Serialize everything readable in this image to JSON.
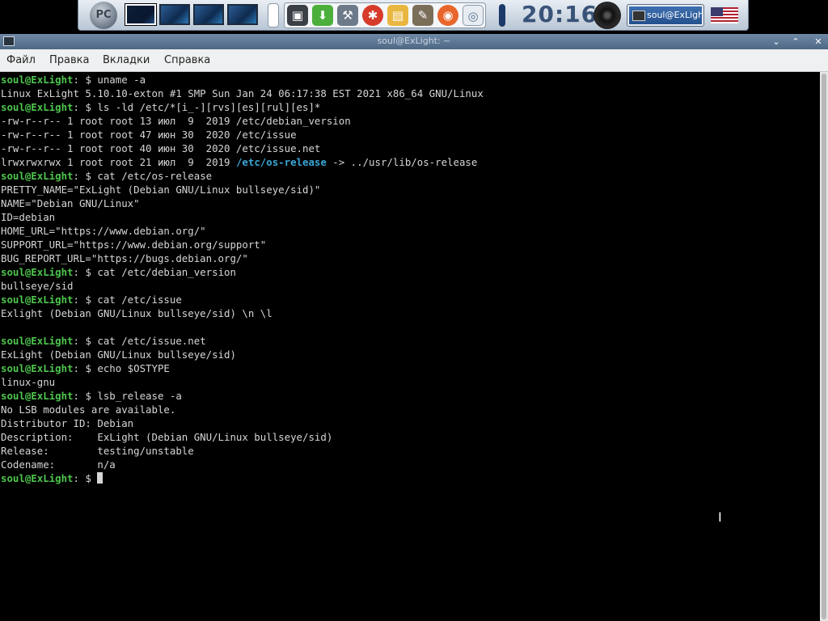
{
  "panel": {
    "logo_text": "PC",
    "clock": "20:16",
    "task_button_label": "soul@ExLight...",
    "icons": [
      "monitor-icon",
      "download-icon",
      "settings-tools-icon",
      "software-icon",
      "folder-icon",
      "gimp-icon",
      "firefox-icon",
      "network-icon"
    ]
  },
  "window": {
    "title": "soul@ExLight: ~"
  },
  "menu": {
    "file": "Файл",
    "edit": "Правка",
    "tabs": "Вкладки",
    "help": "Справка"
  },
  "terminal": {
    "prompt_user": "soul@ExLight",
    "prompt_suffix": ": $ ",
    "lines": [
      {
        "type": "cmd",
        "text": "uname -a"
      },
      {
        "type": "out",
        "text": "Linux ExLight 5.10.10-exton #1 SMP Sun Jan 24 06:17:38 EST 2021 x86_64 GNU/Linux"
      },
      {
        "type": "cmd",
        "text": "ls -ld /etc/*[i_-][rvs][es][rul][es]*"
      },
      {
        "type": "out",
        "text": "-rw-r--r-- 1 root root 13 июл  9  2019 /etc/debian_version"
      },
      {
        "type": "out",
        "text": "-rw-r--r-- 1 root root 47 июн 30  2020 /etc/issue"
      },
      {
        "type": "out",
        "text": "-rw-r--r-- 1 root root 40 июн 30  2020 /etc/issue.net"
      },
      {
        "type": "lnk",
        "pre": "lrwxrwxrwx 1 root root 21 июл  9  2019 ",
        "link": "/etc/os-release",
        "post": " -> ../usr/lib/os-release"
      },
      {
        "type": "cmd",
        "text": "cat /etc/os-release"
      },
      {
        "type": "out",
        "text": "PRETTY_NAME=\"ExLight (Debian GNU/Linux bullseye/sid)\""
      },
      {
        "type": "out",
        "text": "NAME=\"Debian GNU/Linux\""
      },
      {
        "type": "out",
        "text": "ID=debian"
      },
      {
        "type": "out",
        "text": "HOME_URL=\"https://www.debian.org/\""
      },
      {
        "type": "out",
        "text": "SUPPORT_URL=\"https://www.debian.org/support\""
      },
      {
        "type": "out",
        "text": "BUG_REPORT_URL=\"https://bugs.debian.org/\""
      },
      {
        "type": "cmd",
        "text": "cat /etc/debian_version"
      },
      {
        "type": "out",
        "text": "bullseye/sid"
      },
      {
        "type": "cmd",
        "text": "cat /etc/issue"
      },
      {
        "type": "out",
        "text": "Exlight (Debian GNU/Linux bullseye/sid) \\n \\l"
      },
      {
        "type": "out",
        "text": ""
      },
      {
        "type": "cmd",
        "text": "cat /etc/issue.net"
      },
      {
        "type": "out",
        "text": "ExLight (Debian GNU/Linux bullseye/sid)"
      },
      {
        "type": "cmd",
        "text": "echo $OSTYPE"
      },
      {
        "type": "out",
        "text": "linux-gnu"
      },
      {
        "type": "cmd",
        "text": "lsb_release -a"
      },
      {
        "type": "out",
        "text": "No LSB modules are available."
      },
      {
        "type": "out",
        "text": "Distributor ID: Debian"
      },
      {
        "type": "out",
        "text": "Description:    ExLight (Debian GNU/Linux bullseye/sid)"
      },
      {
        "type": "out",
        "text": "Release:        testing/unstable"
      },
      {
        "type": "out",
        "text": "Codename:       n/a"
      },
      {
        "type": "prompt",
        "text": ""
      }
    ]
  },
  "colors": {
    "prompt_user": "#4ec64e",
    "symlink": "#3aa6d6",
    "terminal_bg": "#000000",
    "terminal_fg": "#d6d6d6"
  }
}
